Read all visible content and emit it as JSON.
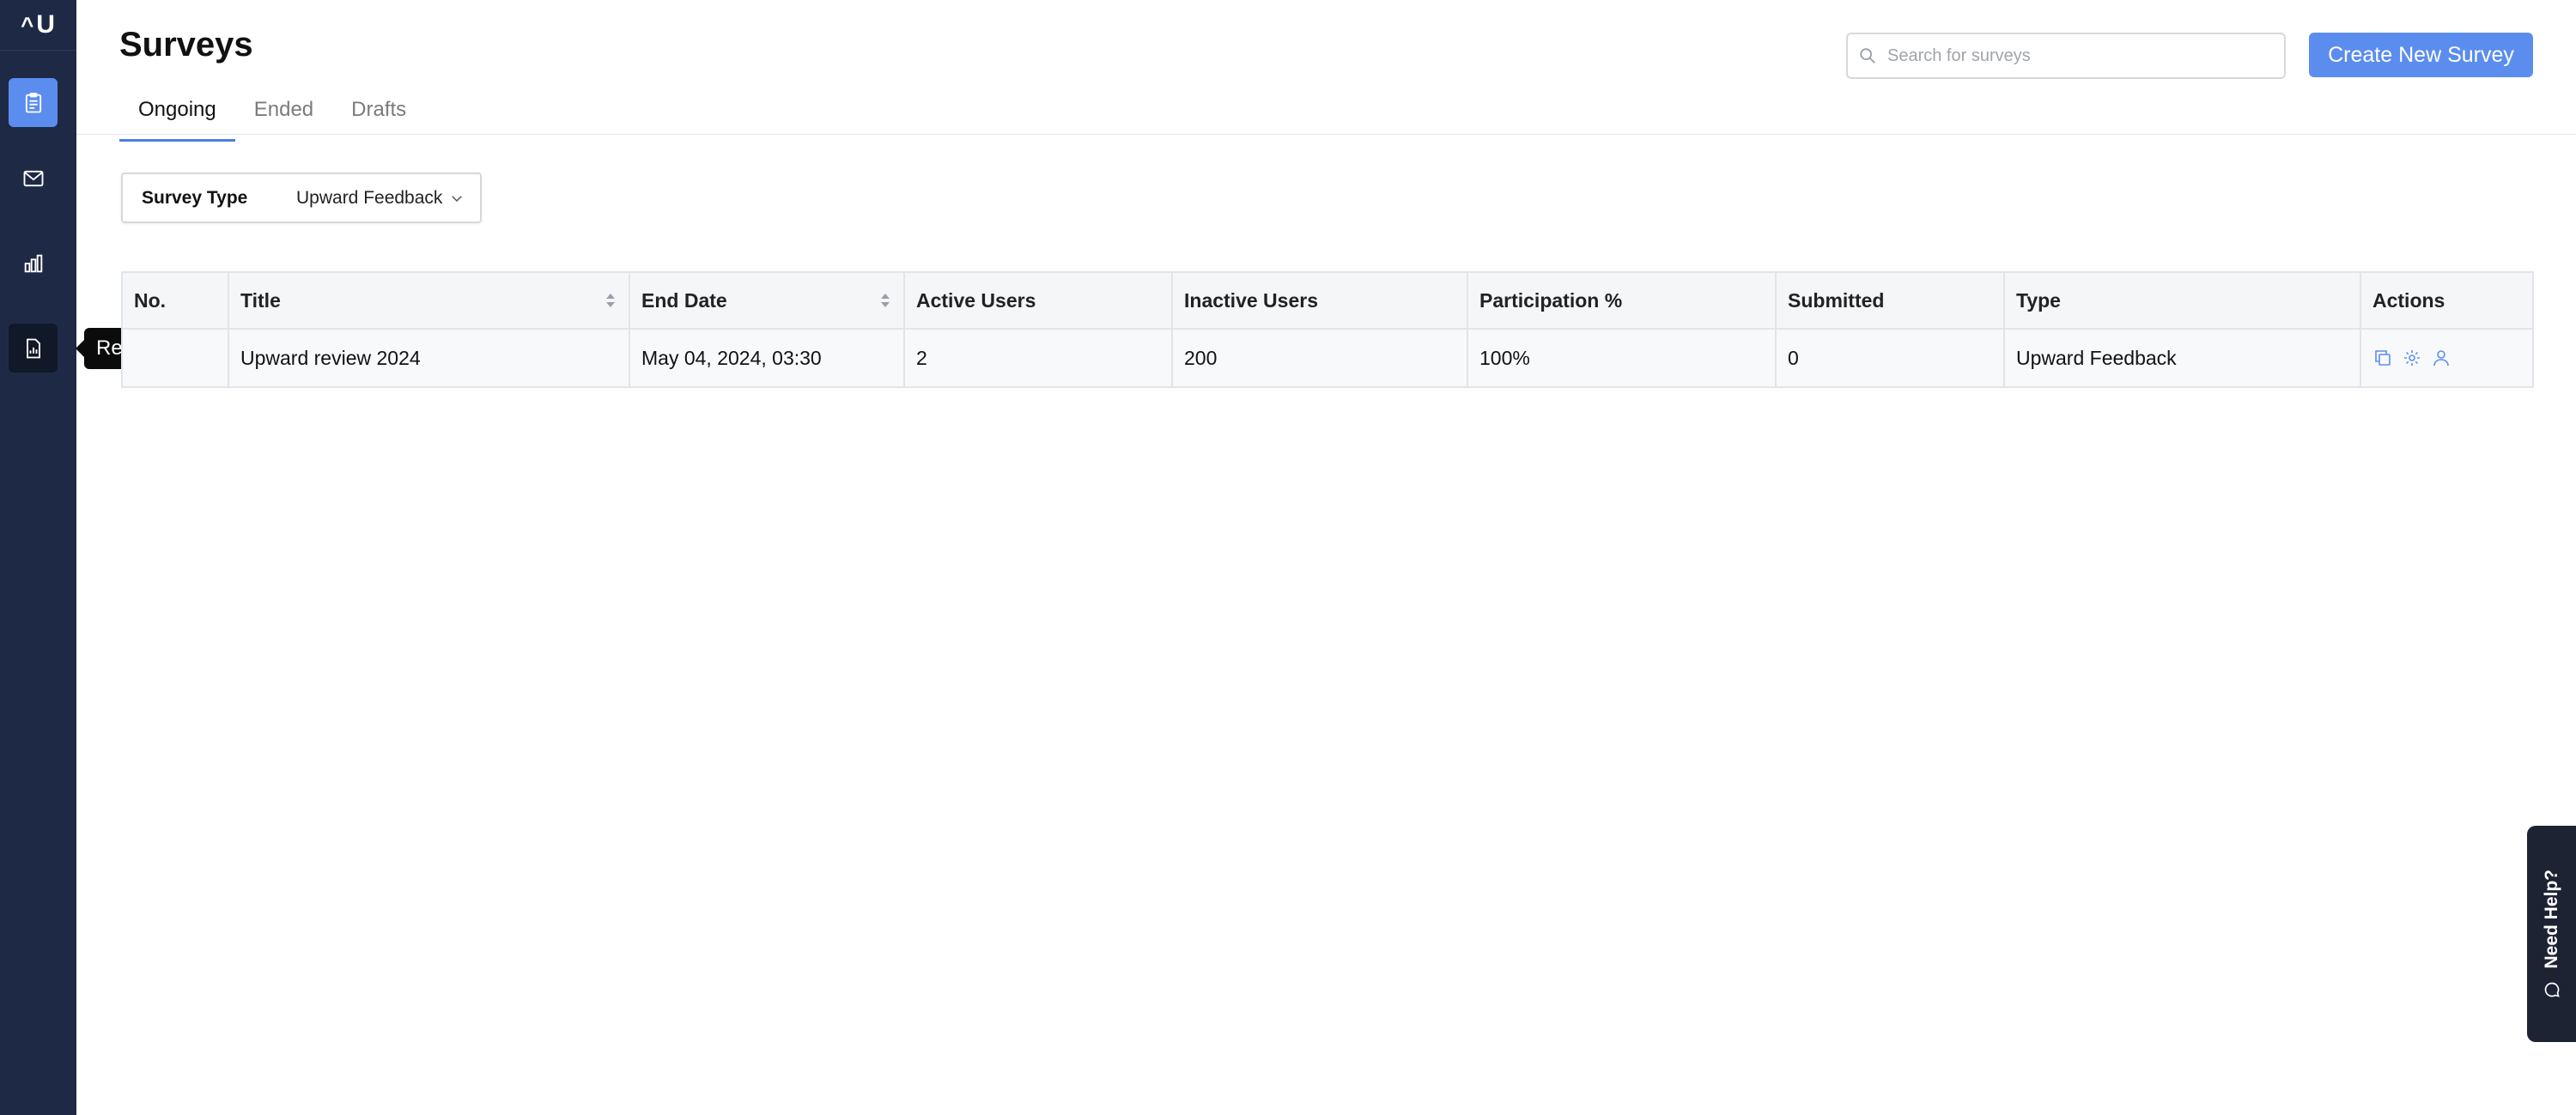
{
  "app": {
    "logo_caret": "^",
    "logo_text": "U"
  },
  "sidebar": {
    "items": [
      {
        "name": "surveys",
        "icon": "clipboard-icon",
        "active": true
      },
      {
        "name": "mail",
        "icon": "mail-icon",
        "active": false
      },
      {
        "name": "analytics",
        "icon": "bar-chart-icon",
        "active": false
      },
      {
        "name": "reports",
        "icon": "report-icon",
        "active": false
      }
    ],
    "tooltip": "Reports"
  },
  "header": {
    "title": "Surveys",
    "tabs": [
      {
        "label": "Ongoing",
        "active": true
      },
      {
        "label": "Ended",
        "active": false
      },
      {
        "label": "Drafts",
        "active": false
      }
    ],
    "search_placeholder": "Search for surveys",
    "create_button": "Create New Survey"
  },
  "filter": {
    "label": "Survey Type",
    "value": "Upward Feedback"
  },
  "table": {
    "columns": [
      "No.",
      "Title",
      "End Date",
      "Active Users",
      "Inactive Users",
      "Participation %",
      "Submitted",
      "Type",
      "Actions"
    ],
    "rows": [
      {
        "no": "",
        "title": "Upward review 2024",
        "end_date": "May 04, 2024, 03:30",
        "active_users": "2",
        "inactive_users": "200",
        "participation": "100%",
        "submitted": "0",
        "type": "Upward Feedback"
      }
    ]
  },
  "help": {
    "label": "Need Help?"
  },
  "colors": {
    "sidebar_bg": "#1e2a45",
    "accent": "#5b8def",
    "tooltip_bg": "#0b0b0b",
    "help_bg": "#1d2332"
  }
}
